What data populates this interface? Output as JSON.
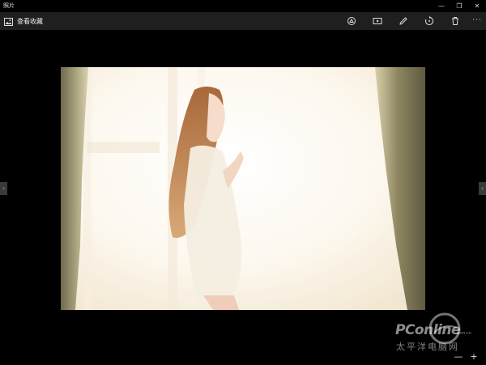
{
  "app": {
    "title": "照片"
  },
  "window_controls": {
    "minimize": "—",
    "maximize": "❐",
    "close": "✕"
  },
  "command_bar": {
    "collection_label": "查看收藏",
    "tools": [
      "share-icon",
      "slideshow-icon",
      "edit-icon",
      "rotate-icon",
      "delete-icon"
    ],
    "more": "···"
  },
  "viewer": {
    "prev": "‹",
    "next": "›",
    "zoom_out": "—",
    "zoom_in": "+"
  },
  "watermark": {
    "brand": "PConline",
    "domain": ".com.cn",
    "chinese": "太平洋电脑网"
  }
}
